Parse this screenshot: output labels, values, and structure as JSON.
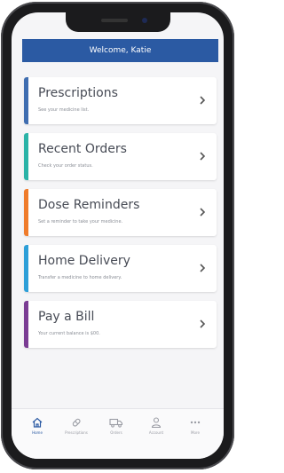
{
  "header": {
    "title": "Welcome, Katie"
  },
  "colors": {
    "header_bg": "#2b5aa3",
    "prescriptions": "#3f6db0",
    "recent_orders": "#2ab3a7",
    "dose_reminders": "#ef7b2b",
    "home_delivery": "#2d9fd8",
    "pay_a_bill": "#7a3c93"
  },
  "cards": [
    {
      "title": "Prescriptions",
      "subtitle": "See your medicine list."
    },
    {
      "title": "Recent Orders",
      "subtitle": "Check your order status."
    },
    {
      "title": "Dose Reminders",
      "subtitle": "Set a reminder to take your medicine."
    },
    {
      "title": "Home Delivery",
      "subtitle": "Transfer a medicine to home delivery."
    },
    {
      "title": "Pay a Bill",
      "subtitle": "Your current balance is $00."
    }
  ],
  "tabs": [
    {
      "label": "Home",
      "icon": "home-icon"
    },
    {
      "label": "Prescriptions",
      "icon": "pill-icon"
    },
    {
      "label": "Orders",
      "icon": "truck-icon"
    },
    {
      "label": "Account",
      "icon": "user-icon"
    },
    {
      "label": "More",
      "icon": "more-icon"
    }
  ]
}
